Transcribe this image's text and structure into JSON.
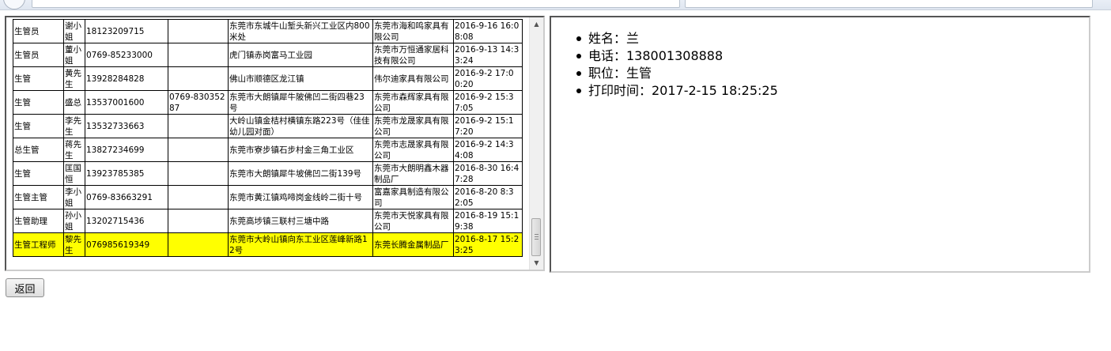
{
  "table": {
    "rows": [
      [
        "生管员",
        "谢小姐",
        "18123209715",
        "",
        "东莞市东城牛山堑头新兴工业区内800米处",
        "东莞市海和鸣家具有限公司",
        "2016-9-16 16:08:08"
      ],
      [
        "生管员",
        "董小姐",
        "0769-85233000",
        "",
        "虎门镇赤岗富马工业园",
        "东莞市万恒通家居科技有限公司",
        "2016-9-13 14:33:24"
      ],
      [
        "生管",
        "黄先生",
        "13928284828",
        "",
        "佛山市顺德区龙江镇",
        "伟尔迪家具有限公司",
        "2016-9-2 17:00:20"
      ],
      [
        "生管",
        "盛总",
        "13537001600",
        "0769-83035287",
        "东莞市大朗镇犀牛陂佛凹二街四巷23号",
        "东莞市森辉家具有限公司",
        "2016-9-2 15:37:05"
      ],
      [
        "生管",
        "李先生",
        "13532733663",
        "",
        "大岭山镇金桔村横镇东路223号（佳佳幼儿园对面）",
        "东莞市龙晟家具有限公司",
        "2016-9-2 15:17:20"
      ],
      [
        "总生管",
        "蒋先生",
        "13827234699",
        "",
        "东莞市寮步镇石步村金三角工业区",
        "东莞市志晟家具有限公司",
        "2016-9-2 14:34:08"
      ],
      [
        "生管",
        "匡国恒",
        "13923785385",
        "",
        "东莞市大朗镇犀牛坡佛凹二街139号",
        "东莞市大朗明鑫木器制品厂",
        "2016-8-30 16:47:28"
      ],
      [
        "生管主管",
        "李小姐",
        "0769-83663291",
        "",
        "东莞市黄江镇鸡啼岗金线岭二街十号",
        "富嘉家具制造有限公司",
        "2016-8-20 8:32:05"
      ],
      [
        "生管助理",
        "孙小姐",
        "13202715436",
        "",
        "东莞高埗镇三联村三塘中路",
        "东莞市天悦家具有限公司",
        "2016-8-19 15:19:38"
      ],
      [
        "生管工程师",
        "黎先生",
        "076985619349",
        "",
        "东莞市大岭山镇向东工业区莲峰新路12号",
        "东莞长腾金属制品厂",
        "2016-8-17 15:23:25"
      ]
    ],
    "highlight_row": 9,
    "highlight_color": "#ffff00"
  },
  "scrollbar": {
    "up_icon": "up-arrow-icon",
    "down_icon": "down-arrow-icon"
  },
  "details": {
    "items": [
      "姓名：兰",
      "电话：138001308888",
      "职位：生管",
      "打印时间：2017-2-15 18:25:25"
    ]
  },
  "actions": {
    "back_label": "返回"
  }
}
